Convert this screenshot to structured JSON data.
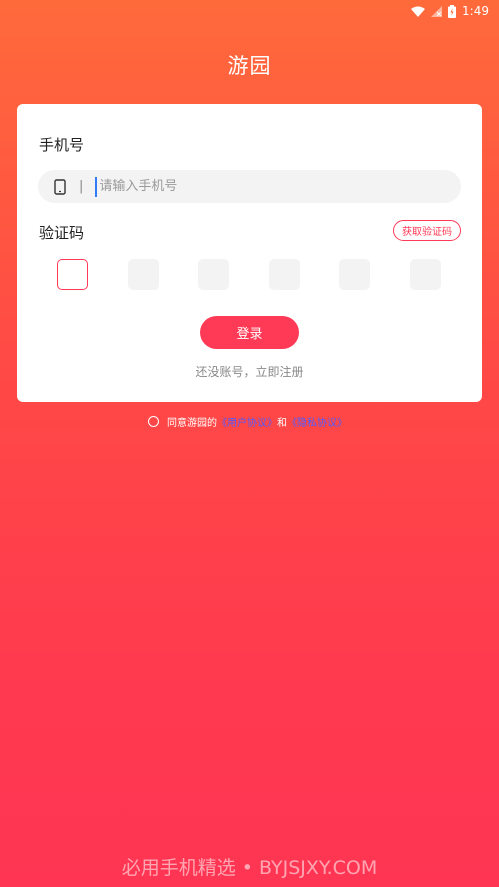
{
  "status_bar": {
    "time": "1:49",
    "icons": [
      "wifi-icon",
      "no-signal-icon",
      "battery-icon"
    ]
  },
  "app": {
    "title": "游园"
  },
  "form": {
    "phone_label": "手机号",
    "phone_separator": "|",
    "phone_placeholder": "请输入手机号",
    "phone_value": "",
    "code_label": "验证码",
    "get_code_label": "获取验证码",
    "code_digits": [
      "",
      "",
      "",
      "",
      "",
      ""
    ],
    "login_label": "登录",
    "register_text": "还没账号，立即注册"
  },
  "agreement": {
    "prefix": "同意游园的",
    "user_agreement": "《用户协议》",
    "and": "和",
    "privacy_policy": "《隐私协议》",
    "checked": false
  },
  "watermark": "必用手机精选 • BYJSJXY.COM",
  "colors": {
    "accent": "#ff3a56",
    "link": "#4e5bff",
    "gradient_top": "#ff6a3b",
    "gradient_bottom": "#ff3553"
  }
}
